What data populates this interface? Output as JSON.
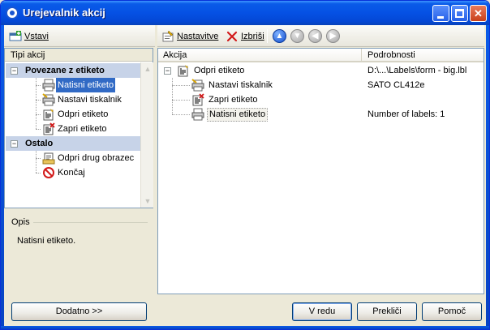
{
  "window": {
    "title": "Urejevalnik akcij"
  },
  "left_toolbar": {
    "insert_label": "Vstavi"
  },
  "right_toolbar": {
    "settings_label": "Nastavitve",
    "delete_label": "Izbriši"
  },
  "action_types": {
    "header": "Tipi akcij",
    "groups": [
      {
        "label": "Povezane z etiketo",
        "items": [
          {
            "label": "Natisni etiketo",
            "icon": "printer-icon",
            "selected": true
          },
          {
            "label": "Nastavi tiskalnik",
            "icon": "printer-settings-icon"
          },
          {
            "label": "Odpri etiketo",
            "icon": "open-label-icon"
          },
          {
            "label": "Zapri etiketo",
            "icon": "close-label-icon"
          }
        ]
      },
      {
        "label": "Ostalo",
        "items": [
          {
            "label": "Odpri drug obrazec",
            "icon": "open-form-icon"
          },
          {
            "label": "Končaj",
            "icon": "stop-icon"
          }
        ]
      }
    ]
  },
  "description": {
    "label": "Opis",
    "text": "Natisni etiketo."
  },
  "actions_table": {
    "columns": [
      "Akcija",
      "Podrobnosti"
    ],
    "rows": [
      {
        "action": "Odpri etiketo",
        "details": "D:\\...\\Labels\\form - big.lbl"
      },
      {
        "action": "Nastavi tiskalnik",
        "details": "SATO CL412e"
      },
      {
        "action": "Zapri etiketo",
        "details": ""
      },
      {
        "action": "Natisni etiketo",
        "details": "Number of labels: 1"
      }
    ]
  },
  "buttons": {
    "more": "Dodatno >>",
    "ok": "V redu",
    "cancel": "Prekliči",
    "help": "Pomoč"
  },
  "colors": {
    "titlebar": "#0551e4",
    "selection": "#316ac5",
    "group_header": "#c7d3e8"
  }
}
